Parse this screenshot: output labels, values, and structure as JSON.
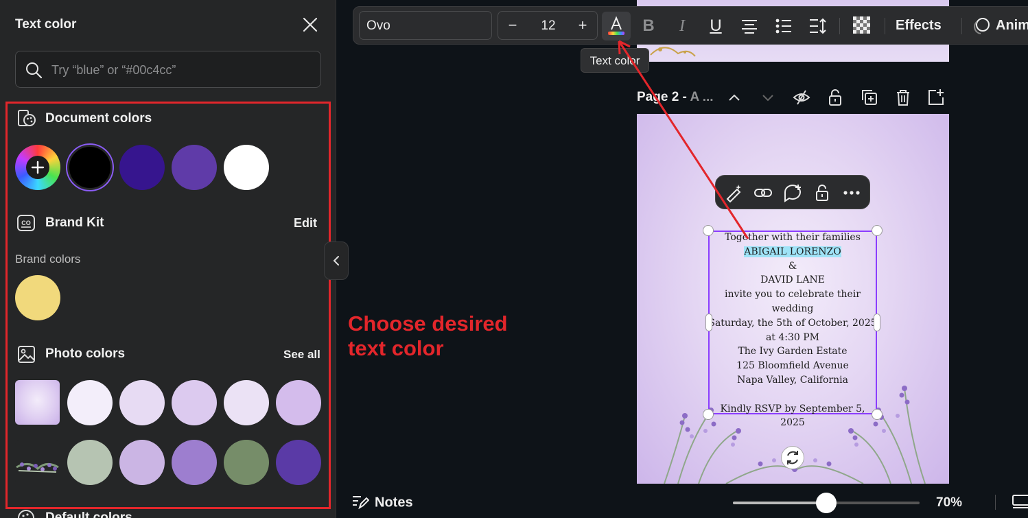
{
  "panel": {
    "title": "Text color",
    "search_placeholder": "Try “blue” or “#00c4cc”",
    "document_colors": {
      "title": "Document colors",
      "swatches": [
        "#000000",
        "#36158e",
        "#5f3ba8",
        "#ffffff"
      ]
    },
    "brand_kit": {
      "title": "Brand Kit",
      "edit_label": "Edit",
      "brand_colors_label": "Brand colors",
      "swatches": [
        "#f1d97c"
      ]
    },
    "photo_colors": {
      "title": "Photo colors",
      "see_all_label": "See all",
      "row1": [
        "#f3eefa",
        "#e7dbf3",
        "#dccaef",
        "#ebe2f5",
        "#d4bcec"
      ],
      "row2": [
        "#b6c4b2",
        "#cbb5e4",
        "#9d7ecf",
        "#768d69",
        "#5a3aa6"
      ]
    },
    "default_colors": {
      "title": "Default colors"
    }
  },
  "annotation": {
    "text": "Choose desired\ntext color",
    "color": "#e3262b"
  },
  "toolbar": {
    "font_name": "Ovo",
    "font_size": "12",
    "minus_label": "−",
    "plus_label": "+",
    "effects_label": "Effects",
    "animate_label": "Anim",
    "tooltip": "Text color"
  },
  "pagebar": {
    "label": "Page 2 - ",
    "label_dim": "A ..."
  },
  "invitation": {
    "line1": "Together with their families",
    "line2": "ABIGAIL LORENZO",
    "line3": "&",
    "line4": "DAVID LANE",
    "line5": "invite you to celebrate their wedding",
    "line6": "Saturday, the 5th of October, 2025",
    "line7": "at 4:30 PM",
    "line8": "The Ivy Garden Estate",
    "line9": "125 Bloomfield Avenue",
    "line10": "Napa Valley, California",
    "line11": "Kindly RSVP by September 5, 2025"
  },
  "bottom": {
    "notes_label": "Notes",
    "zoom_label": "70%",
    "zoom_level": 0.5
  },
  "accent": "#8b3dff"
}
